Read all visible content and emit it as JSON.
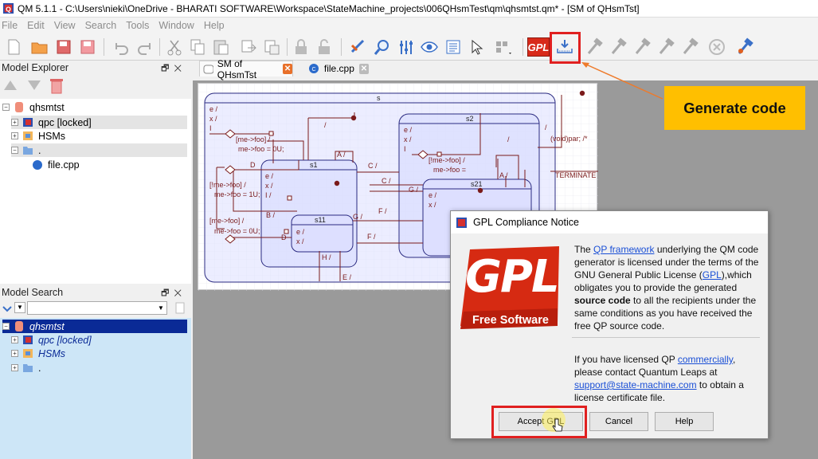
{
  "window": {
    "title": "QM 5.1.1 - C:\\Users\\nieki\\OneDrive - BHARATI SOFTWARE\\Workspace\\StateMachine_projects\\006QHsmTest\\qm\\qhsmtst.qm* - [SM of QHsmTst]"
  },
  "menu": [
    "File",
    "Edit",
    "View",
    "Search",
    "Tools",
    "Window",
    "Help"
  ],
  "toolbar": {
    "gpl_label": "GPL"
  },
  "tabs": [
    {
      "label": "SM of QHsmTst"
    },
    {
      "label": "file.cpp"
    }
  ],
  "model_explorer": {
    "title": "Model Explorer",
    "items": [
      {
        "label": "qhsmtst"
      },
      {
        "label": "qpc [locked]"
      },
      {
        "label": "HSMs"
      },
      {
        "label": "."
      },
      {
        "label": "file.cpp"
      }
    ]
  },
  "model_search": {
    "title": "Model Search",
    "query": "",
    "items": [
      {
        "label": "qhsmtst"
      },
      {
        "label": "qpc [locked]"
      },
      {
        "label": "HSMs"
      },
      {
        "label": "."
      }
    ]
  },
  "diagram": {
    "top_state": "s",
    "states": [
      "s1",
      "s11",
      "s2",
      "s21"
    ],
    "labels": {
      "e": "e /",
      "x": "x /",
      "i": "I",
      "g1": "[me->foo] /",
      "g1b": "me->foo = 0U;",
      "d": "D",
      "c": "C /",
      "a": "A /",
      "g2": "[!me->foo] /",
      "g2b": "me->foo = 1U;",
      "g3": "[me->foo] /",
      "g3b": "me->foo = 0U;",
      "b": "B /",
      "g": "G /",
      "f": "F /",
      "h": "H /",
      "ee": "E /",
      "slash": "/",
      "voidpar": "(void)par; /*",
      "g4": "[!me->foo] /",
      "g4b": "me->foo =",
      "terminate": "TERMINATE",
      "s1e": "e /",
      "s1x": "x /",
      "s1i": "I /",
      "s11e": "e /",
      "s11x": "x /",
      "s2e": "e /",
      "s2x": "x /",
      "s2i": "I",
      "s21e": "e /",
      "s21x": "x /"
    }
  },
  "dialog": {
    "title": "GPL Compliance Notice",
    "logo_text": "GPL",
    "logo_sub": "Free Software",
    "para1": {
      "t1": "The ",
      "link1": "QP framework",
      "t2": " underlying the QM code generator is licensed under the terms of the GNU General Public License (",
      "link2": "GPL",
      "t3": "),which obligates you to provide the generated ",
      "bold": "source code",
      "t4": " to all the recipients under the same conditions as you have received the free QP source code."
    },
    "para2": {
      "t1": "If you have licensed QP ",
      "link1": "commercially",
      "t2": ", please contact Quantum Leaps at ",
      "link2": "support@state-machine.com",
      "t3": " to obtain a license certificate file."
    },
    "buttons": {
      "accept": "Accept GPL",
      "cancel": "Cancel",
      "help": "Help"
    }
  },
  "annotation": {
    "callout": "Generate code"
  },
  "colors": {
    "highlight_red": "#e02020",
    "callout_bg": "#ffbf00",
    "arrow": "#ee7a2a",
    "selection_blue": "#0a2a96",
    "search_bg": "#cde6f7"
  }
}
